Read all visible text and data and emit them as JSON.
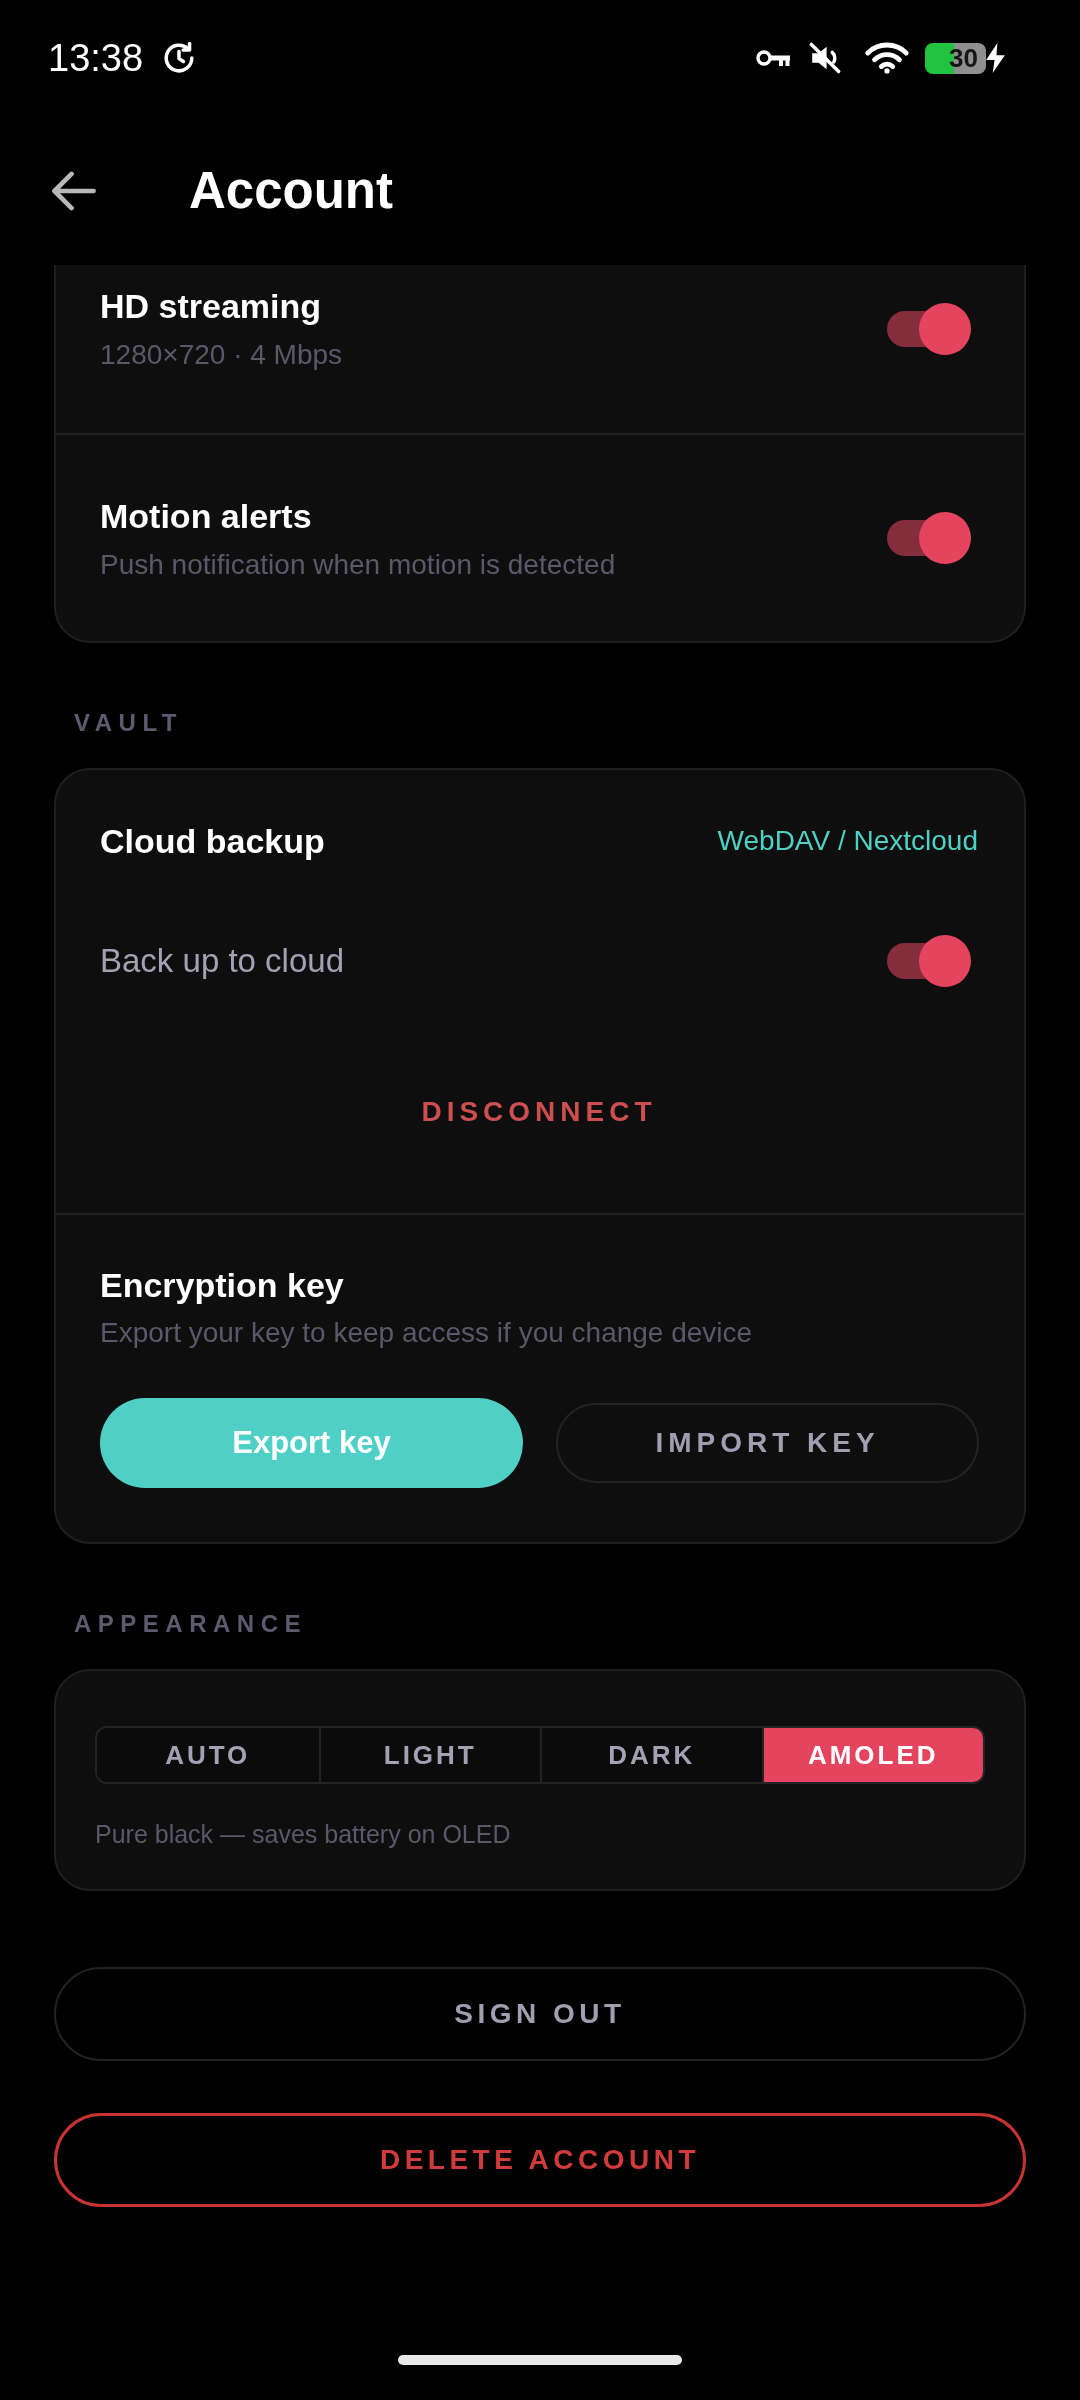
{
  "status_bar": {
    "time": "13:38",
    "battery": "30"
  },
  "header": {
    "title": "Account"
  },
  "settings_card": {
    "rows": [
      {
        "title": "HD streaming",
        "subtitle": "1280×720 · 4 Mbps",
        "on": true
      },
      {
        "title": "Motion alerts",
        "subtitle": "Push notification when motion is detected",
        "on": true
      }
    ]
  },
  "vault": {
    "label": "VAULT",
    "cloud_backup": {
      "title": "Cloud backup",
      "provider": "WebDAV / Nextcloud",
      "toggle": {
        "label": "Back up to cloud",
        "on": true
      },
      "action": "DISCONNECT"
    },
    "encryption_key": {
      "title": "Encryption key",
      "subtitle": "Export your key to keep access if you change device",
      "buttons": [
        {
          "label": "Export key",
          "kind": "filled"
        },
        {
          "label": "IMPORT KEY",
          "kind": "outlined"
        }
      ]
    }
  },
  "appearance": {
    "label": "APPEARANCE",
    "options": [
      {
        "label": "AUTO",
        "selected": false
      },
      {
        "label": "LIGHT",
        "selected": false
      },
      {
        "label": "DARK",
        "selected": false
      },
      {
        "label": "AMOLED",
        "selected": true
      }
    ],
    "hint": "Pure black — saves battery on OLED"
  },
  "actions": [
    {
      "label": "SIGN OUT",
      "kind": "neutral"
    },
    {
      "label": "DELETE ACCOUNT",
      "kind": "danger"
    }
  ]
}
